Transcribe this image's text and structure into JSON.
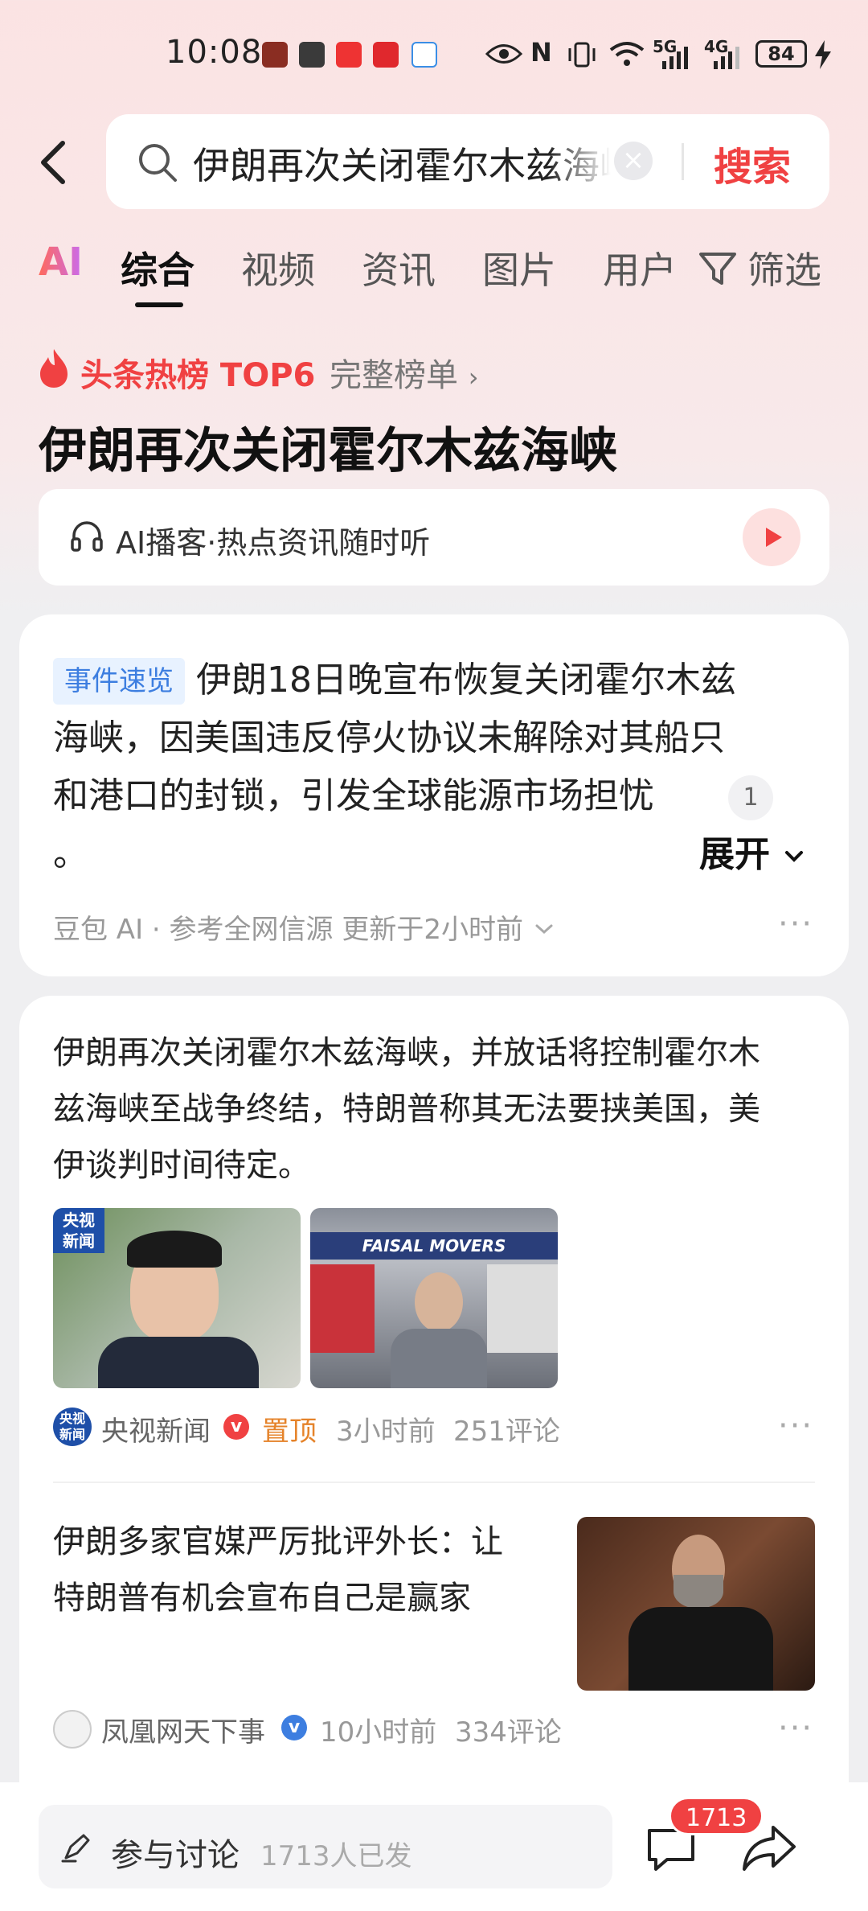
{
  "status_bar": {
    "time": "10:08",
    "network_5g": "5G",
    "network_4g": "4G",
    "battery": "84"
  },
  "search": {
    "query": "伊朗再次关闭霍尔木兹海峡",
    "button": "搜索"
  },
  "tabs": {
    "ai": "AI",
    "items": [
      "综合",
      "视频",
      "资讯",
      "图片",
      "用户"
    ],
    "filter": "筛选",
    "active": "综合"
  },
  "hot": {
    "label": "头条热榜 TOP6",
    "link": "完整榜单",
    "headline": "伊朗再次关闭霍尔木兹海峡",
    "podcast": "AI播客·热点资讯随时听"
  },
  "event": {
    "tag": "事件速览",
    "line1": "伊朗18日晚宣布恢复关闭霍尔木兹",
    "line2": "海峡，因美国违反停火协议未解除对其船只",
    "line3": "和港口的封锁，引发全球能源市场担忧",
    "line4": "。",
    "ref_count": "1",
    "expand": "展开",
    "source": "豆包 AI · 参考全网信源 更新于2小时前"
  },
  "articles": [
    {
      "text_lines": [
        "伊朗再次关闭霍尔木兹海峡，并放话将控制霍尔木",
        "兹海峡至战争终结，特朗普称其无法要挟美国，美",
        "伊谈判时间待定。"
      ],
      "image1_logo": "央视\n新闻",
      "image2_sign": "FAISAL MOVERS",
      "source": "央视新闻",
      "pinned": "置顶",
      "time": "3小时前",
      "comments": "251评论"
    },
    {
      "text_lines": [
        "伊朗多家官媒严厉批评外长：让",
        "特朗普有机会宣布自己是赢家"
      ],
      "source": "凤凰网天下事",
      "time": "10小时前",
      "comments": "334评论"
    }
  ],
  "bottom": {
    "discuss": "参与讨论",
    "discuss_count": "1713人已发",
    "comment_badge": "1713"
  },
  "colors": {
    "accent": "#f04142",
    "tag_blue": "#3d7ee0",
    "pinned": "#e5832a"
  }
}
